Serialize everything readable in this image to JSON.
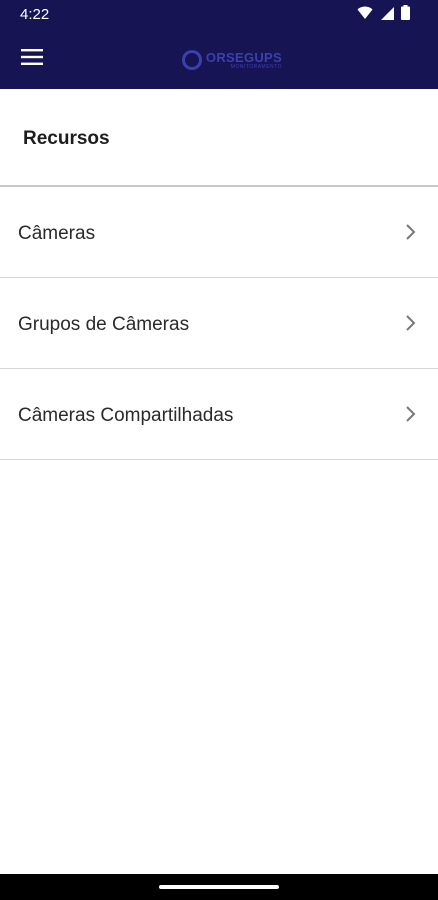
{
  "status_bar": {
    "time": "4:22",
    "icons": [
      "wifi-icon",
      "signal-icon",
      "battery-icon"
    ]
  },
  "app_bar": {
    "menu_icon": "hamburger-menu-icon",
    "logo": {
      "name": "ORSEGUPS",
      "tagline": "MONITORAMENTO"
    },
    "background_color": "#171453",
    "logo_color": "#3c3fb0"
  },
  "section": {
    "title": "Recursos"
  },
  "menu_items": [
    {
      "label": "Câmeras",
      "icon": "chevron-right-icon"
    },
    {
      "label": "Grupos de Câmeras",
      "icon": "chevron-right-icon"
    },
    {
      "label": "Câmeras Compartilhadas",
      "icon": "chevron-right-icon"
    }
  ]
}
